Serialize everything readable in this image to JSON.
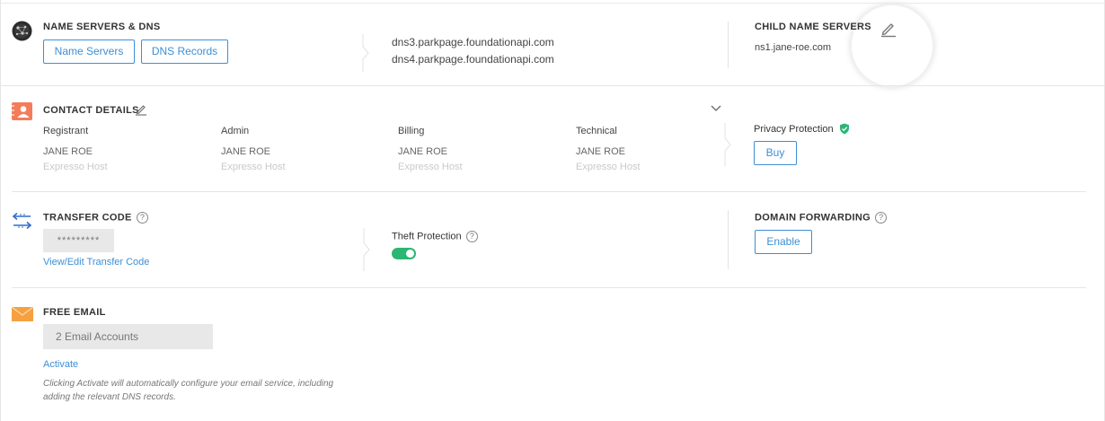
{
  "nameservers": {
    "title": "NAME SERVERS & DNS",
    "name_servers_button": "Name Servers",
    "dns_records_button": "DNS Records",
    "servers": [
      "dns3.parkpage.foundationapi.com",
      "dns4.parkpage.foundationapi.com"
    ],
    "icon": "globe-icon"
  },
  "child_ns": {
    "title": "CHILD NAME SERVERS",
    "value": "ns1.jane-roe.com",
    "edit_icon": "pencil-icon"
  },
  "contact": {
    "title": "CONTACT DETAILS",
    "icon": "contact-card-icon",
    "columns": [
      {
        "label": "Registrant",
        "name": "JANE ROE",
        "org": "Expresso Host"
      },
      {
        "label": "Admin",
        "name": "JANE ROE",
        "org": "Expresso Host"
      },
      {
        "label": "Billing",
        "name": "JANE ROE",
        "org": "Expresso Host"
      },
      {
        "label": "Technical",
        "name": "JANE ROE",
        "org": "Expresso Host"
      }
    ],
    "privacy_label": "Privacy Protection",
    "buy_button": "Buy"
  },
  "transfer": {
    "title": "TRANSFER CODE",
    "icon": "transfer-arrows-icon",
    "code_mask": "*********",
    "view_edit_link": "View/Edit Transfer Code",
    "theft_label": "Theft Protection",
    "theft_enabled": true
  },
  "forwarding": {
    "title": "DOMAIN FORWARDING",
    "enable_button": "Enable"
  },
  "email": {
    "title": "FREE EMAIL",
    "icon": "envelope-icon",
    "accounts": "2 Email Accounts",
    "activate_link": "Activate",
    "note_line1": "Clicking Activate will automatically configure your email service, including",
    "note_line2": "adding the relevant DNS records."
  },
  "help_glyph": "?",
  "colors": {
    "accent": "#3d8fd6",
    "toggle_on": "#2bb673",
    "shield": "#2bb673",
    "contact_icon": "#f47c5a",
    "email_icon": "#f5a142"
  }
}
